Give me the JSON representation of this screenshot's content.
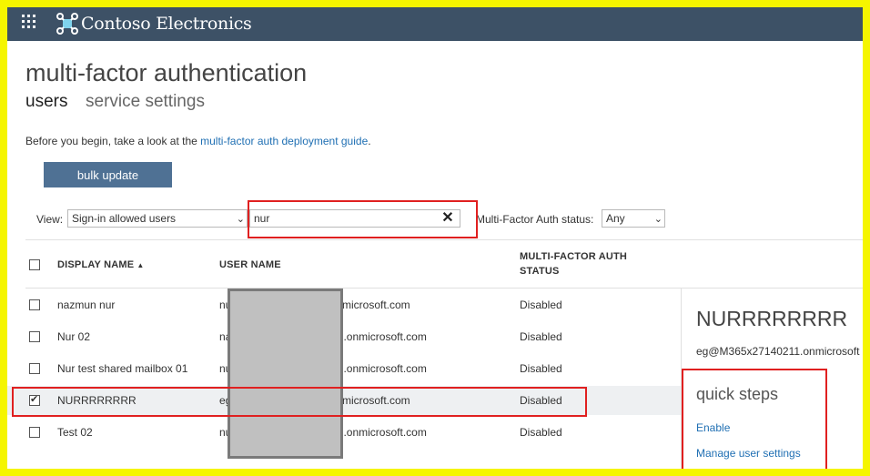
{
  "app": {
    "name": "Contoso Electronics"
  },
  "page": {
    "title": "multi-factor authentication",
    "tabs": [
      {
        "label": "users"
      },
      {
        "label": "service settings"
      }
    ],
    "intro_text": "Before you begin, take a look at the ",
    "intro_link": "multi-factor auth deployment guide",
    "intro_end": "."
  },
  "toolbar": {
    "bulk_update": "bulk update"
  },
  "filters": {
    "view_label": "View:",
    "view_value": "Sign-in allowed users",
    "search_value": "nur",
    "mfa_label": "Multi-Factor Auth status:",
    "mfa_value": "Any"
  },
  "table": {
    "columns": {
      "display_name": "DISPLAY NAME",
      "user_name": "USER NAME",
      "mfa_line1": "MULTI-FACTOR AUTH",
      "mfa_line2": "STATUS"
    },
    "rows": [
      {
        "display_name": "nazmun nur",
        "user_prefix": "nu",
        "user_suffix": "microsoft.com",
        "status": "Disabled",
        "checked": false
      },
      {
        "display_name": "Nur 02",
        "user_prefix": "na",
        "user_suffix": "11.onmicrosoft.com",
        "status": "Disabled",
        "checked": false
      },
      {
        "display_name": "Nur test shared mailbox 01",
        "user_prefix": "nu",
        "user_suffix": "11.onmicrosoft.com",
        "status": "Disabled",
        "checked": false
      },
      {
        "display_name": "NURRRRRRRR",
        "user_prefix": "eg",
        "user_suffix": "microsoft.com",
        "status": "Disabled",
        "checked": true
      },
      {
        "display_name": "Test 02",
        "user_prefix": "nu",
        "user_suffix": "11.onmicrosoft.com",
        "status": "Disabled",
        "checked": false
      }
    ]
  },
  "detail": {
    "name": "NURRRRRRRR",
    "email": "eg@M365x27140211.onmicrosoft",
    "quick_steps_title": "quick steps",
    "links": {
      "enable": "Enable",
      "manage": "Manage user settings"
    }
  },
  "colors": {
    "topbar": "#3d5166",
    "button": "#4f7194",
    "link": "#1f6fb3",
    "highlight": "#e02020",
    "background": "#f5f500"
  }
}
